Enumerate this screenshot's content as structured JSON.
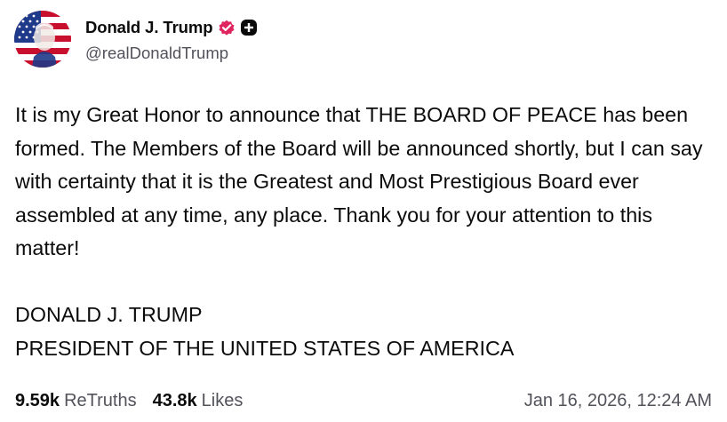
{
  "author": {
    "display_name": "Donald J. Trump",
    "handle": "@realDonaldTrump",
    "avatar_icon": "flag-portrait-avatar",
    "verified_icon": "verified-badge-icon",
    "verified_color": "#e0245e",
    "extra_badge_icon": "plus-badge-icon"
  },
  "post": {
    "paragraphs": [
      "It is my Great Honor to announce that THE BOARD OF PEACE has been formed. The Members of the Board will be announced shortly, but I can say with certainty that it is the Greatest and Most Prestigious Board ever assembled at any time, any place. Thank you for your attention to this matter!"
    ],
    "signature_lines": [
      "DONALD J. TRUMP",
      "PRESIDENT OF THE UNITED STATES OF AMERICA"
    ]
  },
  "stats": {
    "retruths_count": "9.59k",
    "retruths_label": "ReTruths",
    "likes_count": "43.8k",
    "likes_label": "Likes"
  },
  "timestamp": "Jan 16, 2026, 12:24 AM"
}
